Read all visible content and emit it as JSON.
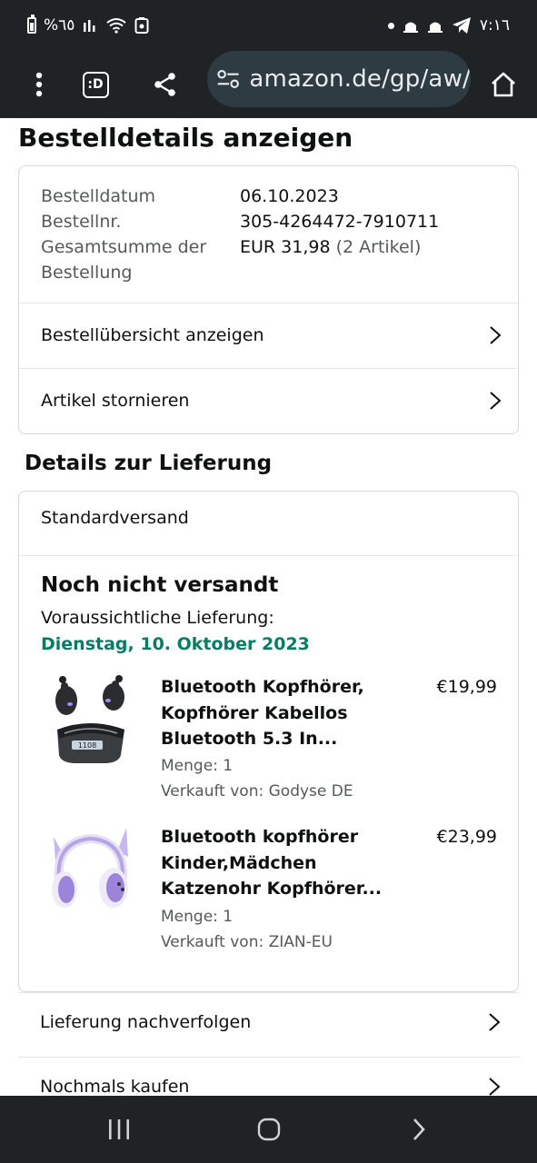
{
  "status_bar": {
    "left_text": "%٦٥",
    "time": "٧:١٦"
  },
  "toolbar": {
    "url": "amazon.de/gp/aw/",
    "tab_label": ":D"
  },
  "page": {
    "title": "Bestelldetails anzeigen"
  },
  "order_info": {
    "date_label": "Bestelldatum",
    "date_value": "06.10.2023",
    "number_label": "Bestellnr.",
    "number_value": "305-4264472-7910711",
    "total_label_line1": "Gesamtsumme der",
    "total_label_line2": "Bestellung",
    "total_value": "EUR 31,98",
    "total_items": "(2 Artikel)",
    "link_overview": "Bestellübersicht anzeigen",
    "link_cancel": "Artikel stornieren"
  },
  "delivery": {
    "section_title": "Details zur Lieferung",
    "shipping_method": "Standardversand",
    "status": "Noch nicht versandt",
    "expected_label": "Voraussichtliche Lieferung:",
    "expected_date": "Dienstag, 10. Oktober 2023"
  },
  "products": [
    {
      "title": "Bluetooth Kopfhörer, Kopfhörer Kabellos Bluetooth 5.3 In...",
      "price": "€19,99",
      "quantity": "Menge: 1",
      "seller": "Verkauft von: Godyse DE"
    },
    {
      "title": "Bluetooth kopfhörer Kinder,Mädchen Katzenohr Kopfhörer...",
      "price": "€23,99",
      "quantity": "Menge: 1",
      "seller": "Verkauft von: ZIAN-EU"
    }
  ],
  "actions": {
    "track": "Lieferung nachverfolgen",
    "buy_again": "Nochmals kaufen"
  },
  "colors": {
    "chrome": "#1f2326",
    "url_bar": "#2f3b42",
    "delivery_green": "#067d62",
    "muted_text": "#565959",
    "border": "#d5d9d9"
  }
}
